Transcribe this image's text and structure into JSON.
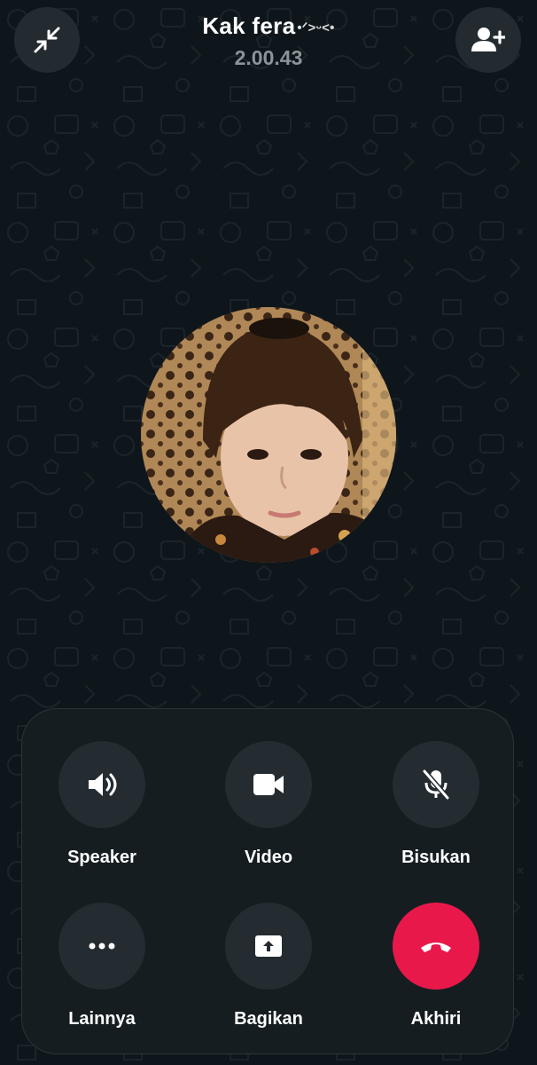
{
  "call": {
    "name": "Kak fera",
    "name_suffix": "•ᐟ>ᵕ<•",
    "timer": "2.00.43"
  },
  "header": {
    "minimize_icon": "minimize-arrows-icon",
    "add_participant_icon": "add-person-icon"
  },
  "controls": [
    {
      "label": "Speaker",
      "icon": "speaker-icon"
    },
    {
      "label": "Video",
      "icon": "video-camera-icon"
    },
    {
      "label": "Bisukan",
      "icon": "mic-off-icon"
    },
    {
      "label": "Lainnya",
      "icon": "more-dots-icon"
    },
    {
      "label": "Bagikan",
      "icon": "share-screen-icon"
    },
    {
      "label": "Akhiri",
      "icon": "end-call-icon"
    }
  ],
  "colors": {
    "background": "#0f161b",
    "panel": "#161d21",
    "button": "#242c31",
    "end_call": "#e8194a",
    "timer_text": "#8a9499"
  }
}
